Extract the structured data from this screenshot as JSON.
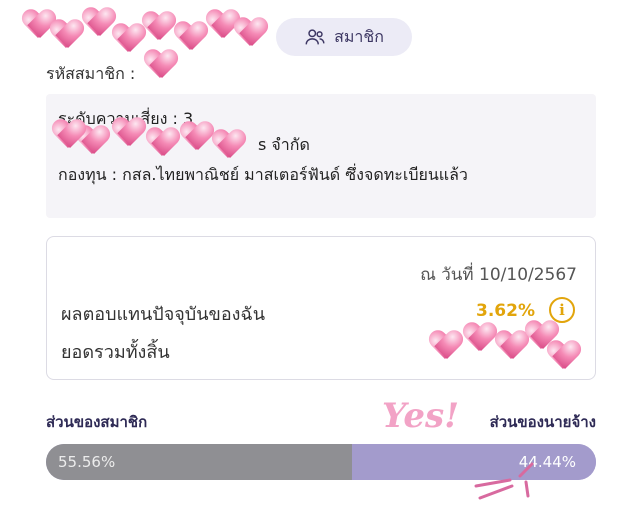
{
  "header": {
    "member_button_label": "สมาชิก",
    "member_id_label": "รหัสสมาชิก : "
  },
  "fund_info": {
    "risk_level": "ระดับความเสี่ยง :  3",
    "company_suffix": "s จำกัด",
    "fund_name": "กองทุน : กสล.ไทยพาณิชย์ มาสเตอร์ฟันด์ ซึ่งจดทะเบียนแล้ว"
  },
  "return_card": {
    "as_of": "ณ วันที่ 10/10/2567",
    "current_return_label": "ผลตอบแทนปัจจุบันของฉัน",
    "current_return_value": "3.62%",
    "info_symbol": "i",
    "total_label": "ยอดรวมทั้งสิ้น"
  },
  "contribution": {
    "member_label": "ส่วนของสมาชิก",
    "employer_label": "ส่วนของนายจ้าง",
    "member_share_text": "55.56%",
    "employer_share_text": "44.44%",
    "member_share": 55.56,
    "employer_share": 44.44,
    "colors": {
      "member": "#8f8f93",
      "employer": "#a39bcc"
    }
  },
  "overlay": {
    "note": "Yes!"
  },
  "icons": {
    "member_button": "people-icon",
    "info": "info-icon"
  }
}
